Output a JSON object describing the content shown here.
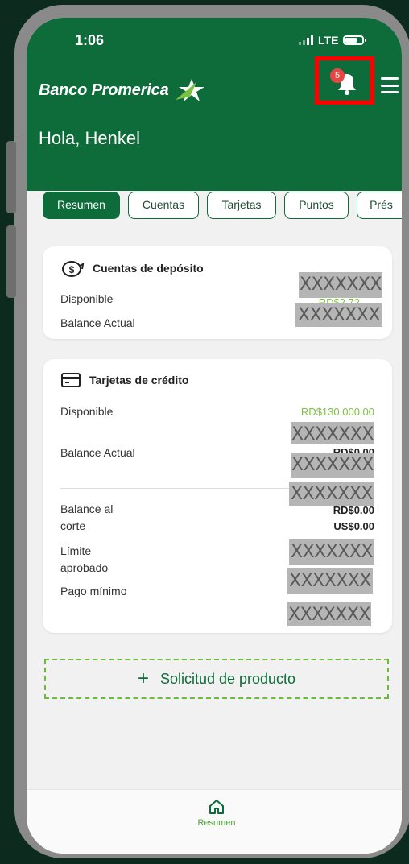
{
  "status_bar": {
    "time": "1:06",
    "network": "LTE"
  },
  "header": {
    "logo_text": "Banco Promerica",
    "notification_count": "5",
    "greeting": "Hola, Henkel"
  },
  "tabs": [
    {
      "label": "Resumen",
      "active": true
    },
    {
      "label": "Cuentas",
      "active": false
    },
    {
      "label": "Tarjetas",
      "active": false
    },
    {
      "label": "Puntos",
      "active": false
    },
    {
      "label": "Prés",
      "active": false
    }
  ],
  "deposit_card": {
    "title": "Cuentas de depósito",
    "rows": [
      {
        "label": "Disponible",
        "value": "XXXXXXX"
      },
      {
        "label": "Balance Actual",
        "value": "XXXXXXX"
      }
    ],
    "peek_value": "RD$2.72"
  },
  "credit_card": {
    "title": "Tarjetas de crédito",
    "disponible_label": "Disponible",
    "disponible_value": "RD$130,000.00",
    "balance_label": "Balance Actual",
    "balance_mask_1": "XXXXXXX",
    "balance_peek": "RD$0.00",
    "balance_mask_2": "XXXXXXX",
    "corte_label_1": "Balance al",
    "corte_label_2": "corte",
    "corte_mask": "XXXXXXX",
    "corte_peek": "RD$0.00",
    "corte_usd": "US$0.00",
    "limite_label_1": "Límite",
    "limite_label_2": "aprobado",
    "limite_mask": "XXXXXXX",
    "limite_prefix": "R",
    "pago_label": "Pago mínimo",
    "pago_mask_1": "XXXXXXX",
    "pago_mask_2": "XXXXXXX"
  },
  "request_button": {
    "label": "Solicitud de producto"
  },
  "bottom_nav": {
    "home_label": "Resumen"
  },
  "colors": {
    "brand_green": "#0e6b3a",
    "accent_green": "#7cc242",
    "highlight_red": "#ff0000"
  }
}
